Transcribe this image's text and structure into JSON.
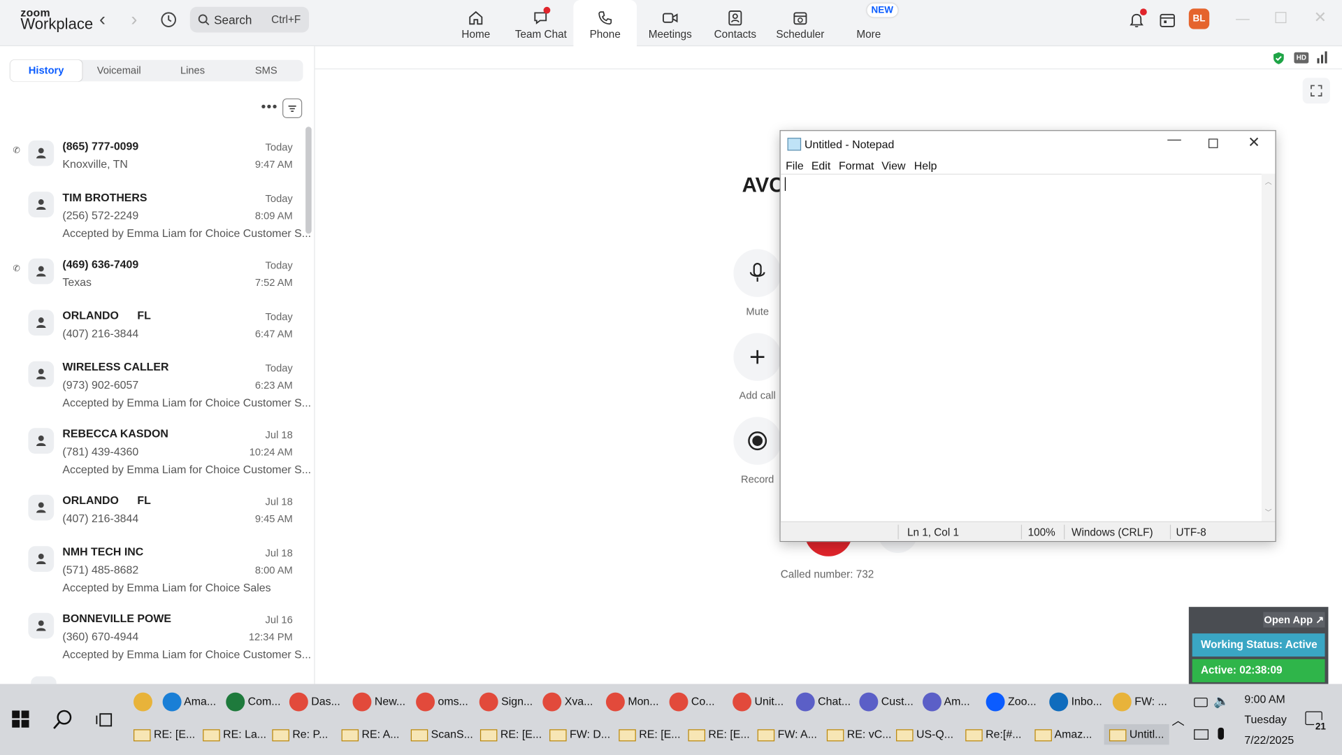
{
  "app": {
    "logo_top": "zoom",
    "logo_bottom": "Workplace"
  },
  "search": {
    "placeholder": "Search",
    "shortcut": "Ctrl+F"
  },
  "nav_tabs": [
    {
      "label": "Home",
      "icon": "home-icon"
    },
    {
      "label": "Team Chat",
      "icon": "chat-icon"
    },
    {
      "label": "Phone",
      "icon": "phone-icon"
    },
    {
      "label": "Meetings",
      "icon": "video-icon"
    },
    {
      "label": "Contacts",
      "icon": "contacts-icon"
    },
    {
      "label": "Scheduler",
      "icon": "calendar-icon"
    },
    {
      "label": "More",
      "icon": "more-icon"
    }
  ],
  "new_badge": "NEW",
  "user": {
    "initials": "BL"
  },
  "phone_tabs": [
    "History",
    "Voicemail",
    "Lines",
    "SMS"
  ],
  "history": [
    {
      "name": "(865) 777-0099",
      "line1": "Knoxville, TN",
      "line2": "",
      "day": "Today",
      "time": "9:47 AM",
      "outbound": true
    },
    {
      "name": "TIM BROTHERS",
      "line1": "(256) 572-2249",
      "line2": "Accepted by Emma Liam for Choice Customer S...",
      "day": "Today",
      "time": "8:09 AM",
      "outbound": false
    },
    {
      "name": "(469) 636-7409",
      "line1": "Texas",
      "line2": "",
      "day": "Today",
      "time": "7:52 AM",
      "outbound": true
    },
    {
      "name": "ORLANDO      FL",
      "line1": "(407) 216-3844",
      "line2": "",
      "day": "Today",
      "time": "6:47 AM",
      "outbound": false
    },
    {
      "name": "WIRELESS CALLER",
      "line1": "(973) 902-6057",
      "line2": "Accepted by Emma Liam for Choice Customer S...",
      "day": "Today",
      "time": "6:23 AM",
      "outbound": false
    },
    {
      "name": "REBECCA KASDON",
      "line1": "(781) 439-4360",
      "line2": "Accepted by Emma Liam for Choice Customer S...",
      "day": "Jul 18",
      "time": "10:24 AM",
      "outbound": false
    },
    {
      "name": "ORLANDO      FL",
      "line1": "(407) 216-3844",
      "line2": "",
      "day": "Jul 18",
      "time": "9:45 AM",
      "outbound": false
    },
    {
      "name": "NMH TECH INC",
      "line1": "(571) 485-8682",
      "line2": "Accepted by Emma Liam for Choice Sales",
      "day": "Jul 18",
      "time": "8:00 AM",
      "outbound": false
    },
    {
      "name": "BONNEVILLE POWE",
      "line1": "(360) 670-4944",
      "line2": "Accepted by Emma Liam for Choice Customer S...",
      "day": "Jul 16",
      "time": "12:34 PM",
      "outbound": false
    }
  ],
  "call": {
    "caller_partial": "AVC",
    "mute": "Mute",
    "add_call": "Add call",
    "record": "Record",
    "called_number": "Called number: 732"
  },
  "notepad": {
    "title": "Untitled - Notepad",
    "menu": [
      "File",
      "Edit",
      "Format",
      "View",
      "Help"
    ],
    "status": {
      "position": "Ln 1, Col 1",
      "zoom": "100%",
      "line_ending": "Windows (CRLF)",
      "encoding": "UTF-8"
    }
  },
  "widget": {
    "open_app": "Open App ↗",
    "working_status": "Working Status: Active",
    "active_timer": "Active: 02:38:09"
  },
  "taskbar": {
    "row1": [
      {
        "label": "",
        "color": "#e8b33a"
      },
      {
        "label": "Ama...",
        "color": "#1a7fd6"
      },
      {
        "label": "Com...",
        "color": "#1e7a3c"
      },
      {
        "label": "Das...",
        "color": "#e24a3b"
      },
      {
        "label": "New...",
        "color": "#e24a3b"
      },
      {
        "label": "oms...",
        "color": "#e24a3b"
      },
      {
        "label": "Sign...",
        "color": "#e24a3b"
      },
      {
        "label": "Xva...",
        "color": "#e24a3b"
      },
      {
        "label": "Mon...",
        "color": "#e24a3b"
      },
      {
        "label": "Co...",
        "color": "#e24a3b"
      },
      {
        "label": "Unit...",
        "color": "#e24a3b"
      },
      {
        "label": "Chat...",
        "color": "#5b5fc7"
      },
      {
        "label": "Cust...",
        "color": "#5b5fc7"
      },
      {
        "label": "Am...",
        "color": "#5b5fc7"
      },
      {
        "label": "Zoo...",
        "color": "#0b5cff"
      },
      {
        "label": "Inbo...",
        "color": "#0f6cbd"
      },
      {
        "label": "FW: ...",
        "color": "#e8b33a"
      }
    ],
    "row2": [
      {
        "label": "RE: [E..."
      },
      {
        "label": "RE: La..."
      },
      {
        "label": "Re: P..."
      },
      {
        "label": "RE: A..."
      },
      {
        "label": "ScanS..."
      },
      {
        "label": "RE: [E..."
      },
      {
        "label": "FW: D..."
      },
      {
        "label": "RE: [E..."
      },
      {
        "label": "RE: [E..."
      },
      {
        "label": "FW: A..."
      },
      {
        "label": "RE: vC..."
      },
      {
        "label": "US-Q..."
      },
      {
        "label": "Re:[#..."
      },
      {
        "label": "Amaz..."
      },
      {
        "label": "Untitl..."
      }
    ],
    "clock": {
      "time": "9:00 AM",
      "day": "Tuesday",
      "date": "7/22/2025"
    },
    "notifications": "21"
  }
}
